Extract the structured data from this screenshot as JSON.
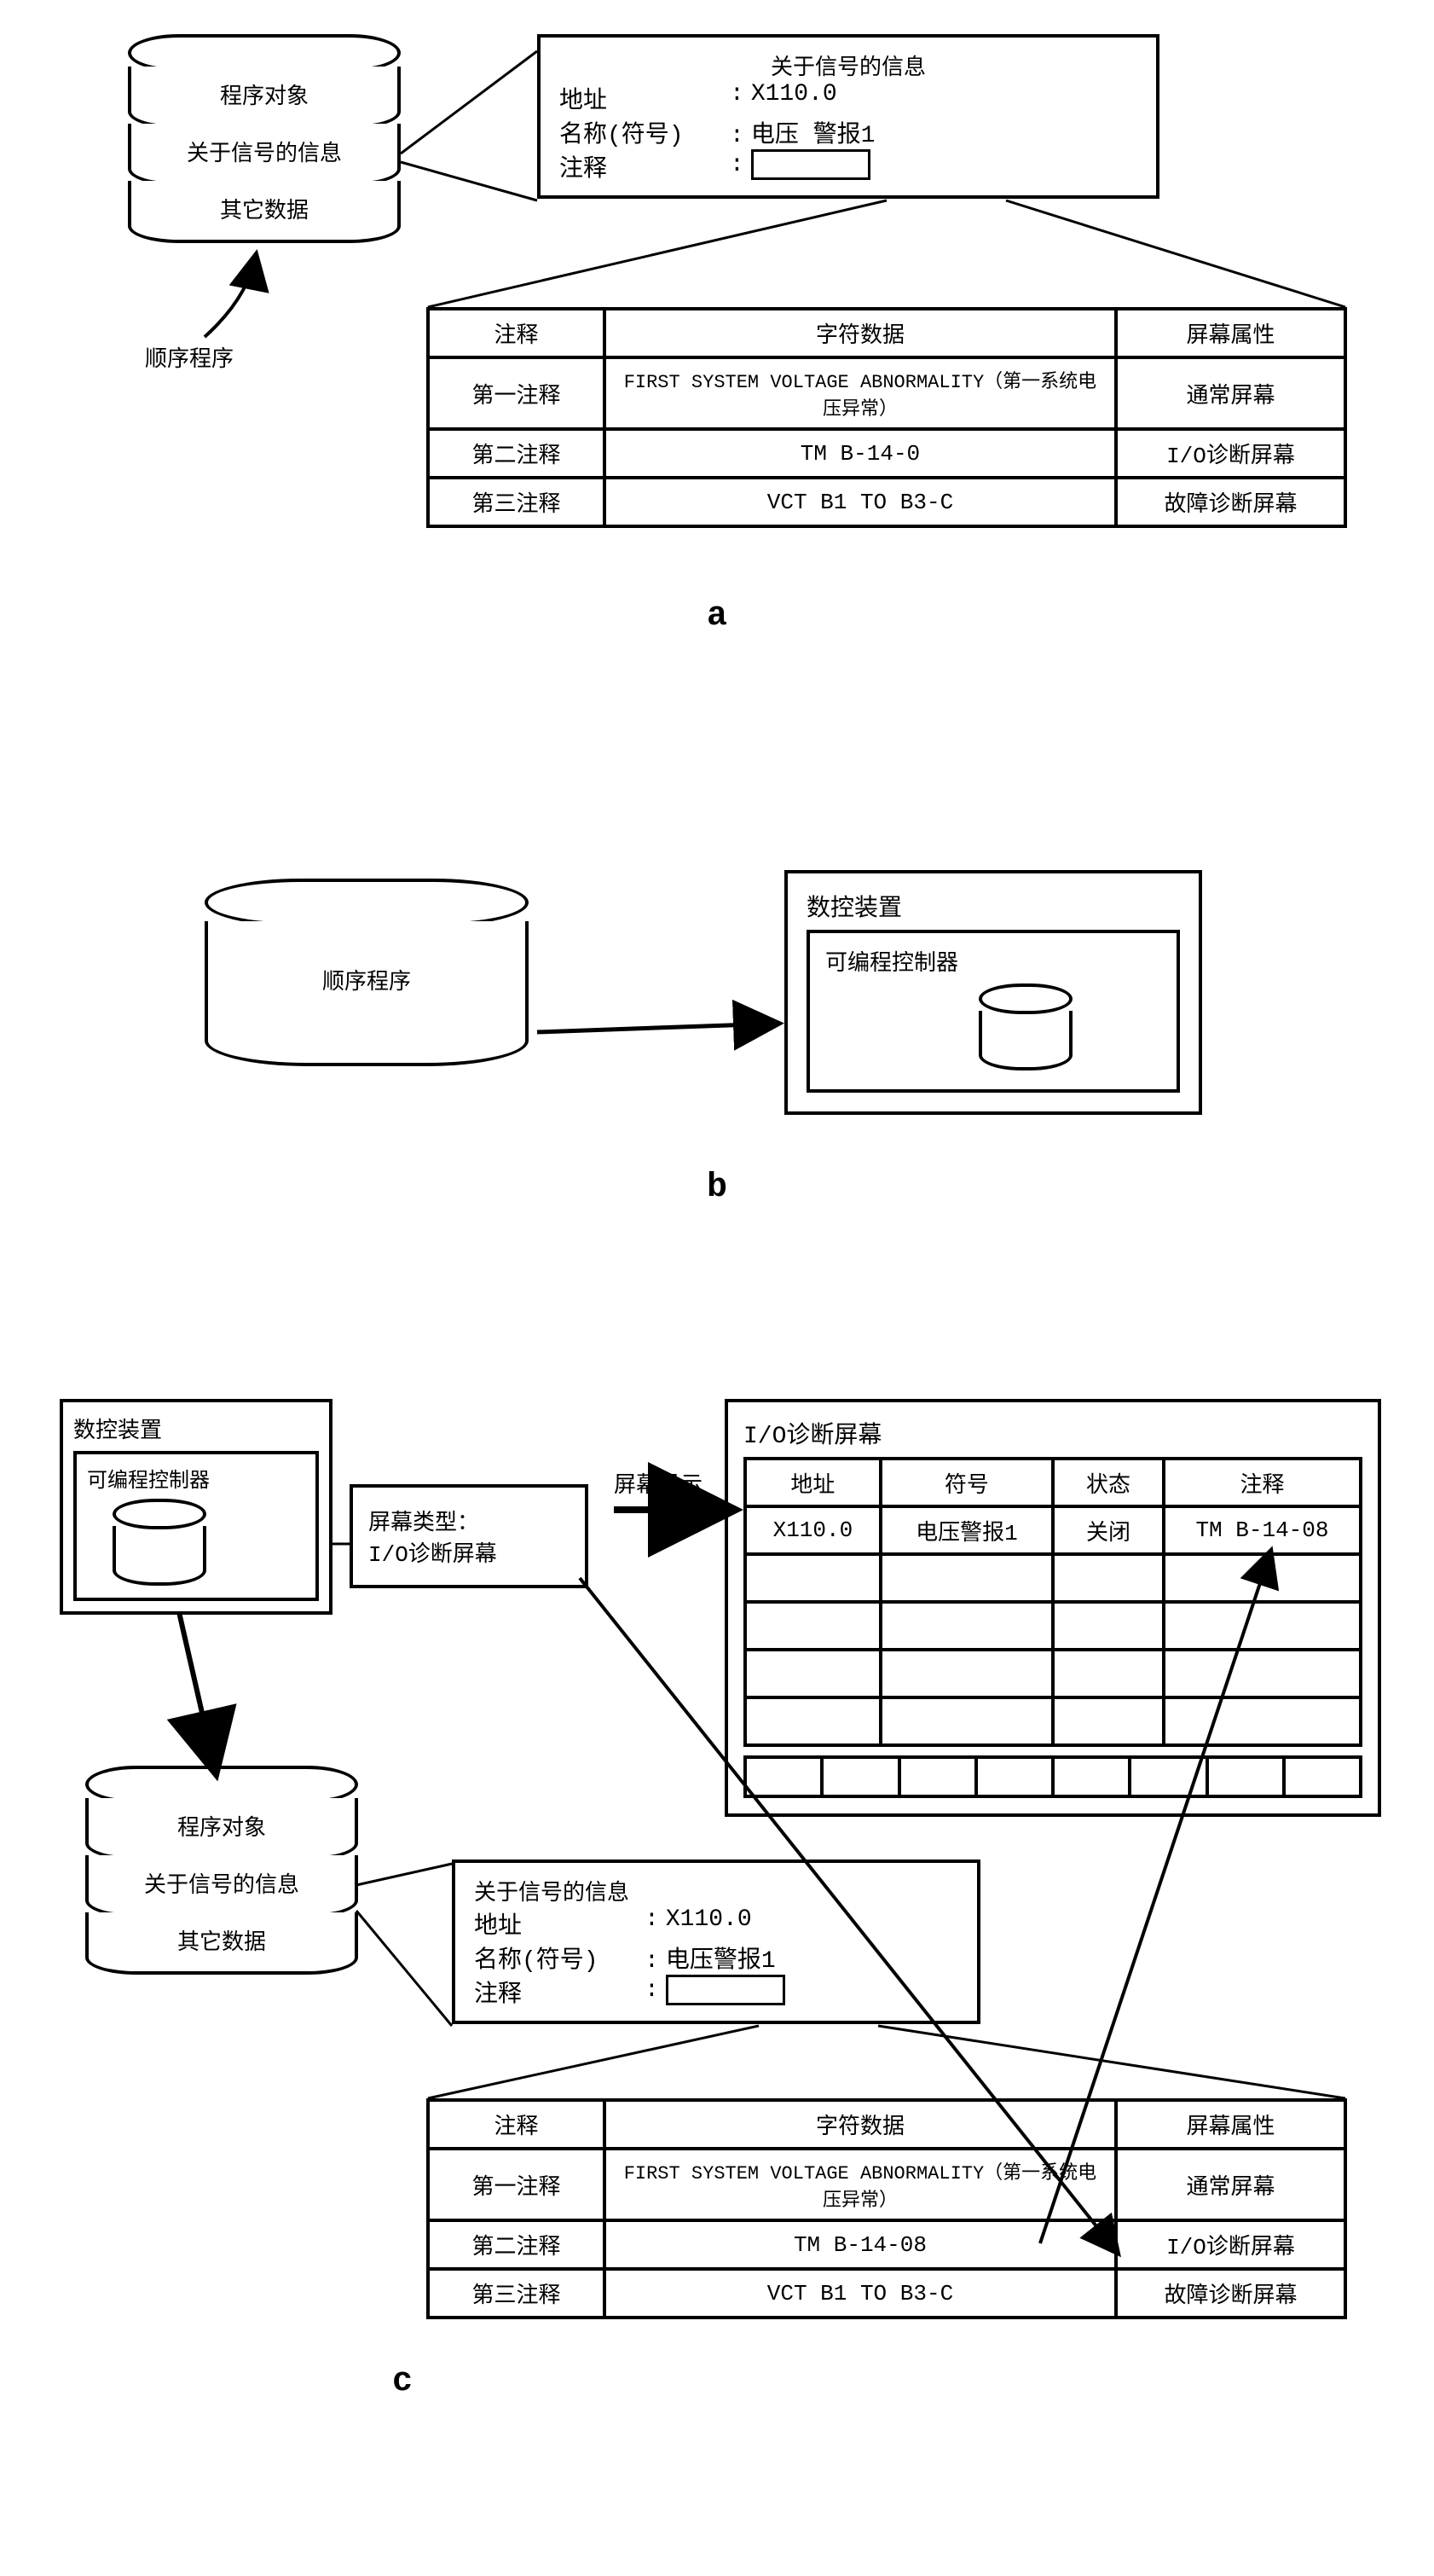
{
  "a": {
    "cyl": {
      "seg1": "程序对象",
      "seg2": "关于信号的信息",
      "seg3": "其它数据"
    },
    "arrow_label": "顺序程序",
    "panel": {
      "title": "关于信号的信息",
      "addr_k": "地址",
      "addr_v": "X110.0",
      "name_k": "名称(符号)",
      "name_v": "电压 警报1",
      "comment_k": "注释"
    },
    "table": {
      "h1": "注释",
      "h2": "字符数据",
      "h3": "屏幕属性",
      "r1c1": "第一注释",
      "r1c2": "FIRST SYSTEM VOLTAGE ABNORMALITY（第一系统电压异常）",
      "r1c3": "通常屏幕",
      "r2c1": "第二注释",
      "r2c2": "TM B-14-0",
      "r2c3": "I/O诊断屏幕",
      "r3c1": "第三注释",
      "r3c2": "VCT B1 TO B3-C",
      "r3c3": "故障诊断屏幕"
    },
    "label": "a"
  },
  "b": {
    "cyl_label": "顺序程序",
    "outer_title": "数控装置",
    "inner_title": "可编程控制器",
    "label": "b"
  },
  "c": {
    "outer_title": "数控装置",
    "inner_title": "可编程控制器",
    "screen_type_box": {
      "l1": "屏幕类型：",
      "l2": "I/O诊断屏幕"
    },
    "screen_arrow_label": "屏幕显示",
    "io_screen": {
      "title": "I/O诊断屏幕",
      "h1": "地址",
      "h2": "符号",
      "h3": "状态",
      "h4": "注释",
      "r1c1": "X110.0",
      "r1c2": "电压警报1",
      "r1c3": "关闭",
      "r1c4": "TM B-14-08"
    },
    "cyl": {
      "seg1": "程序对象",
      "seg2": "关于信号的信息",
      "seg3": "其它数据"
    },
    "panel": {
      "title": "关于信号的信息",
      "addr_k": "地址",
      "addr_v": "X110.0",
      "name_k": "名称(符号)",
      "name_v": "电压警报1",
      "comment_k": "注释"
    },
    "table": {
      "h1": "注释",
      "h2": "字符数据",
      "h3": "屏幕属性",
      "r1c1": "第一注释",
      "r1c2": "FIRST SYSTEM VOLTAGE ABNORMALITY（第一系统电压异常）",
      "r1c3": "通常屏幕",
      "r2c1": "第二注释",
      "r2c2": "TM B-14-08",
      "r2c3": "I/O诊断屏幕",
      "r3c1": "第三注释",
      "r3c2": "VCT B1 TO B3-C",
      "r3c3": "故障诊断屏幕"
    },
    "label": "c"
  }
}
